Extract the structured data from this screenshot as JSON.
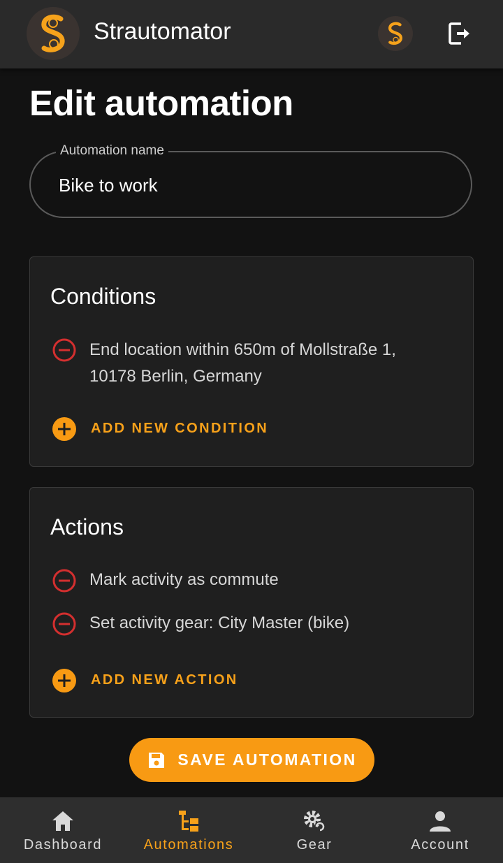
{
  "app": {
    "title": "Strautomator"
  },
  "page": {
    "title": "Edit automation"
  },
  "automation_name": {
    "label": "Automation name",
    "value": "Bike to work"
  },
  "conditions": {
    "title": "Conditions",
    "items": [
      {
        "line1": "End location within 650m of Mollstraße 1,",
        "line2": "10178 Berlin, Germany"
      }
    ],
    "add_label": "ADD NEW CONDITION"
  },
  "actions": {
    "title": "Actions",
    "items": [
      {
        "text": "Mark activity as commute"
      },
      {
        "text": "Set activity gear: City Master (bike)"
      }
    ],
    "add_label": "ADD NEW ACTION"
  },
  "save_button": {
    "label": "SAVE AUTOMATION"
  },
  "bottom_nav": {
    "items": [
      {
        "label": "Dashboard",
        "icon": "home-icon"
      },
      {
        "label": "Automations",
        "icon": "automations-icon",
        "active": true
      },
      {
        "label": "Gear",
        "icon": "gear-icon"
      },
      {
        "label": "Account",
        "icon": "account-icon"
      }
    ]
  },
  "colors": {
    "accent": "#f89a13",
    "remove": "#d32f2f",
    "background": "#121212",
    "surface": "#1f1f1f"
  }
}
